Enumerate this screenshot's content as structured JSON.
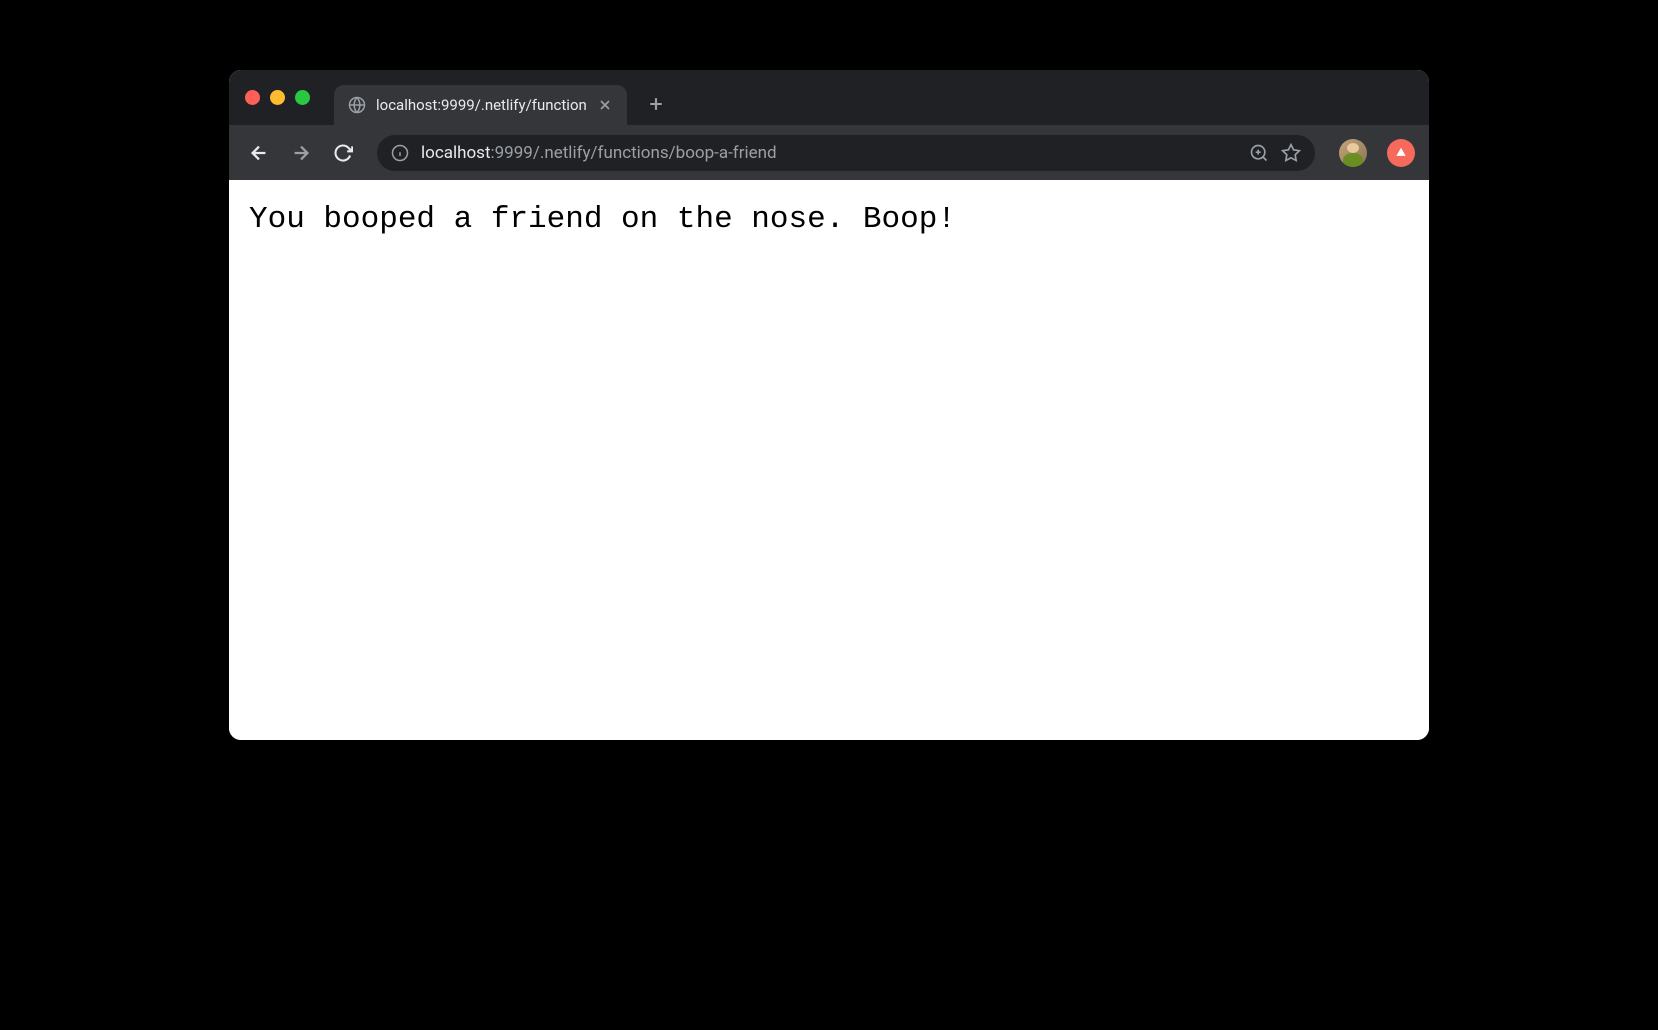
{
  "tab": {
    "title": "localhost:9999/.netlify/function"
  },
  "addressBar": {
    "host": "localhost",
    "path": ":9999/.netlify/functions/boop-a-friend"
  },
  "page": {
    "bodyText": "You booped a friend on the nose. Boop!"
  }
}
